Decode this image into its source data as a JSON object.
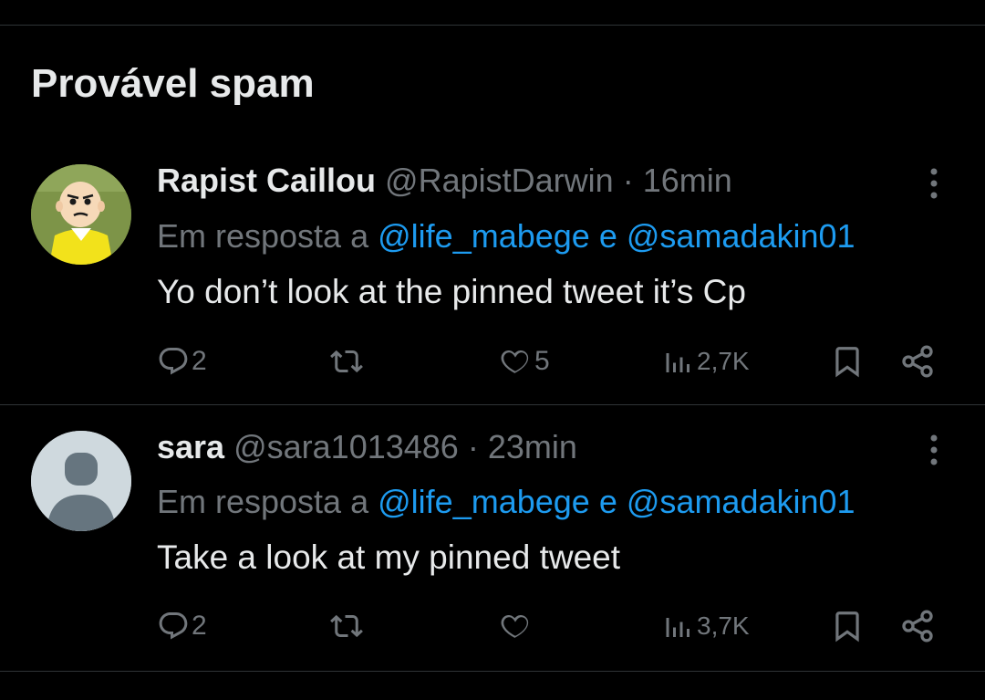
{
  "section": {
    "title": "Provável spam"
  },
  "colors": {
    "background": "#000000",
    "text": "#e7e9ea",
    "muted": "#71767b",
    "link": "#1d9bf0",
    "divider": "#2f3336"
  },
  "tweets": [
    {
      "display_name": "Rapist Caillou",
      "handle": "@RapistDarwin",
      "separator": "·",
      "time": "16min",
      "reply_prefix": "Em resposta a",
      "mention_1": "@life_mabege",
      "conjunction": "e",
      "mention_2": "@samadakin01",
      "text": "Yo don’t look at the pinned tweet it’s Cp",
      "replies": "2",
      "retweets": "",
      "likes": "5",
      "views": "2,7K",
      "avatar_icon": "cartoon-avatar"
    },
    {
      "display_name": "sara",
      "handle": "@sara1013486",
      "separator": "·",
      "time": "23min",
      "reply_prefix": "Em resposta a",
      "mention_1": "@life_mabege",
      "conjunction": "e",
      "mention_2": "@samadakin01",
      "text": "Take a look at my pinned tweet",
      "replies": "2",
      "retweets": "",
      "likes": "",
      "views": "3,7K",
      "avatar_icon": "default-avatar"
    }
  ]
}
